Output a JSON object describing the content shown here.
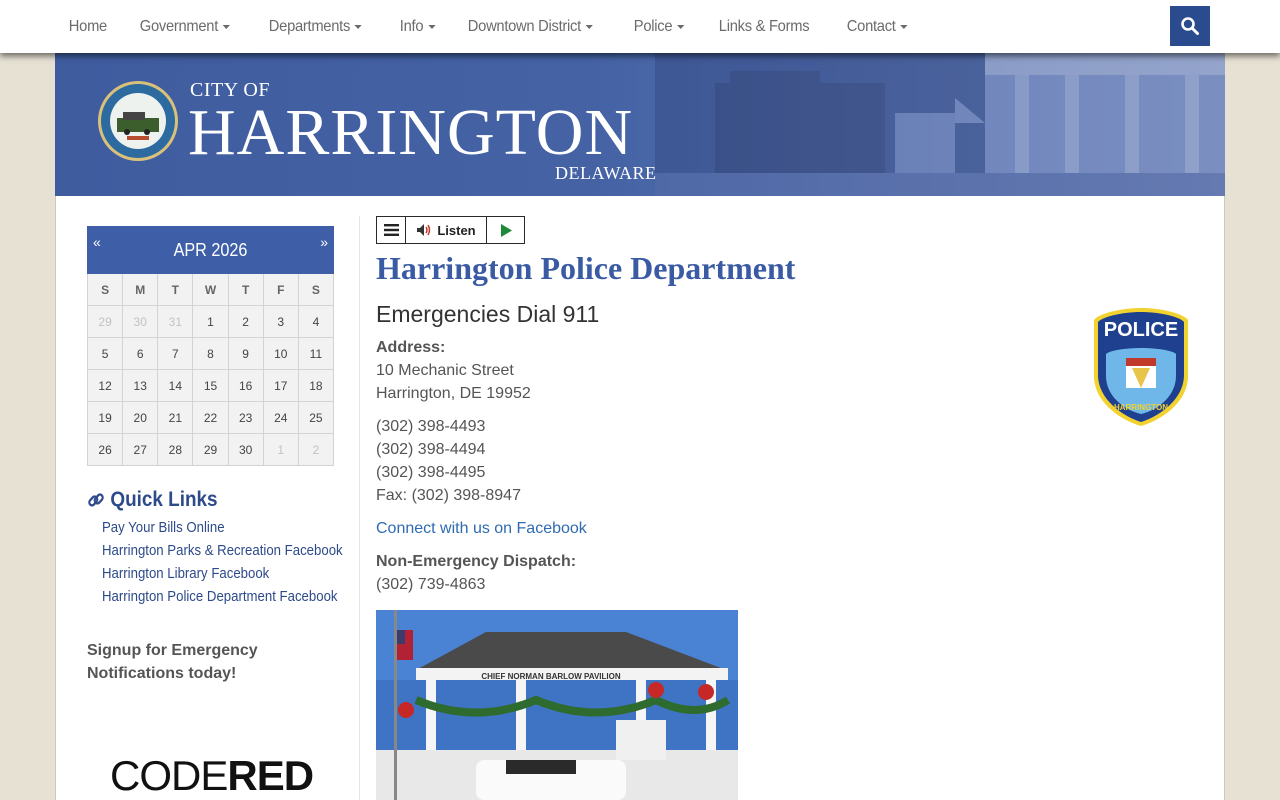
{
  "nav": {
    "items": [
      {
        "label": "Home",
        "dropdown": false
      },
      {
        "label": "Government",
        "dropdown": true
      },
      {
        "label": "Departments",
        "dropdown": true
      },
      {
        "label": "Info",
        "dropdown": true
      },
      {
        "label": "Downtown District",
        "dropdown": true
      },
      {
        "label": "Police",
        "dropdown": true
      },
      {
        "label": "Links & Forms",
        "dropdown": false
      },
      {
        "label": "Contact",
        "dropdown": true
      }
    ],
    "search_icon": "search-icon"
  },
  "banner": {
    "city_of": "CITY OF",
    "city_name": "HARRINGTON",
    "state": "DELAWARE",
    "seal_text": "CITY of HARRINGTON · DELAWARE"
  },
  "calendar": {
    "prev": "«",
    "next": "»",
    "month": "APR 2026",
    "days_of_week": [
      "S",
      "M",
      "T",
      "W",
      "T",
      "F",
      "S"
    ],
    "weeks": [
      [
        {
          "d": "29",
          "m": true
        },
        {
          "d": "30",
          "m": true
        },
        {
          "d": "31",
          "m": true
        },
        {
          "d": "1"
        },
        {
          "d": "2"
        },
        {
          "d": "3"
        },
        {
          "d": "4"
        }
      ],
      [
        {
          "d": "5"
        },
        {
          "d": "6"
        },
        {
          "d": "7"
        },
        {
          "d": "8"
        },
        {
          "d": "9"
        },
        {
          "d": "10"
        },
        {
          "d": "11"
        }
      ],
      [
        {
          "d": "12"
        },
        {
          "d": "13"
        },
        {
          "d": "14"
        },
        {
          "d": "15"
        },
        {
          "d": "16"
        },
        {
          "d": "17"
        },
        {
          "d": "18"
        }
      ],
      [
        {
          "d": "19"
        },
        {
          "d": "20"
        },
        {
          "d": "21"
        },
        {
          "d": "22"
        },
        {
          "d": "23"
        },
        {
          "d": "24"
        },
        {
          "d": "25"
        }
      ],
      [
        {
          "d": "26"
        },
        {
          "d": "27"
        },
        {
          "d": "28"
        },
        {
          "d": "29"
        },
        {
          "d": "30"
        },
        {
          "d": "1",
          "m": true
        },
        {
          "d": "2",
          "m": true
        }
      ]
    ]
  },
  "quick_links": {
    "title": "Quick Links",
    "links": [
      "Pay Your Bills Online",
      "Harrington Parks & Recreation Facebook",
      "Harrington Library Facebook",
      "Harrington Police Department Facebook"
    ]
  },
  "signup": {
    "line1": "Signup for Emergency",
    "line2": "Notifications today!"
  },
  "codered": {
    "light": "CODE",
    "bold": "RED"
  },
  "listen": {
    "label": "Listen"
  },
  "main": {
    "title": "Harrington Police Department",
    "emergency": "Emergencies Dial 911",
    "address_label": "Address:",
    "street": "10 Mechanic Street",
    "city_line": "Harrington, DE 19952",
    "phones": [
      "(302) 398-4493",
      "(302) 398-4494",
      "(302) 398-4495"
    ],
    "fax": "Fax: (302) 398-8947",
    "facebook_link": "Connect with us on Facebook",
    "dispatch_label": "Non-Emergency Dispatch:",
    "dispatch_phone": "(302) 739-4863",
    "badge_text": "POLICE",
    "badge_bottom": "HARRINGTON",
    "photo_caption_sign": "CHIEF NORMAN BARLOW PAVILION"
  },
  "colors": {
    "brand_blue": "#3e5fa8",
    "link_blue": "#2f6bb0",
    "page_bg": "#e6e1d3"
  }
}
